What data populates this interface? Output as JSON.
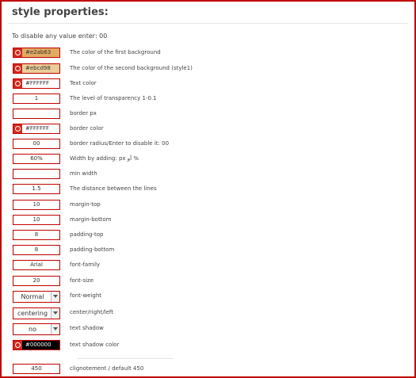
{
  "title": "style properties:",
  "note": "To disable any value enter: 00",
  "rows": [
    {
      "type": "color",
      "value": "#e2ab63",
      "label": "The color of the first background",
      "bg": "#e2ab63",
      "fg": "#333333"
    },
    {
      "type": "color",
      "value": "#ebcd98",
      "label": "The color of the second background (style1)",
      "bg": "#ebcd98",
      "fg": "#333333"
    },
    {
      "type": "color",
      "value": "#FFFFFF",
      "label": "Text color",
      "bg": "#ffffff",
      "fg": "#333333"
    },
    {
      "type": "text",
      "value": "1",
      "label": "The level of transparency 1-0.1"
    },
    {
      "type": "text",
      "value": "",
      "label": "border px"
    },
    {
      "type": "color",
      "value": "#FFFFFF",
      "label": "border color",
      "bg": "#ffffff",
      "fg": "#333333"
    },
    {
      "type": "text",
      "value": "00",
      "label": "border radius/Enter to disable it: 00"
    },
    {
      "type": "text",
      "value": "60%",
      "label": "Width by adding: px أو %"
    },
    {
      "type": "text",
      "value": "",
      "label": "min width"
    },
    {
      "type": "text",
      "value": "1.5",
      "label": "The distance between the lines"
    },
    {
      "type": "text",
      "value": "10",
      "label": "margin-top"
    },
    {
      "type": "text",
      "value": "10",
      "label": "margin-bottom"
    },
    {
      "type": "text",
      "value": "8",
      "label": "padding-top"
    },
    {
      "type": "text",
      "value": "8",
      "label": "padding-bottom"
    },
    {
      "type": "text",
      "value": "Arial",
      "label": "font-family"
    },
    {
      "type": "text",
      "value": "20",
      "label": "font-size"
    },
    {
      "type": "select",
      "value": "Normal",
      "label": "font-weight"
    },
    {
      "type": "select",
      "value": "centering",
      "label": "center/right/left"
    },
    {
      "type": "select",
      "value": "no",
      "label": "text shadow"
    },
    {
      "type": "color",
      "value": "#000000",
      "label": "text shadow color",
      "bg": "#000000",
      "fg": "#ffffff"
    },
    {
      "type": "text",
      "value": "450",
      "label": "clignotement / default 450"
    }
  ],
  "colors": {
    "accent": "#c00000",
    "picker": "#d12a1f"
  }
}
